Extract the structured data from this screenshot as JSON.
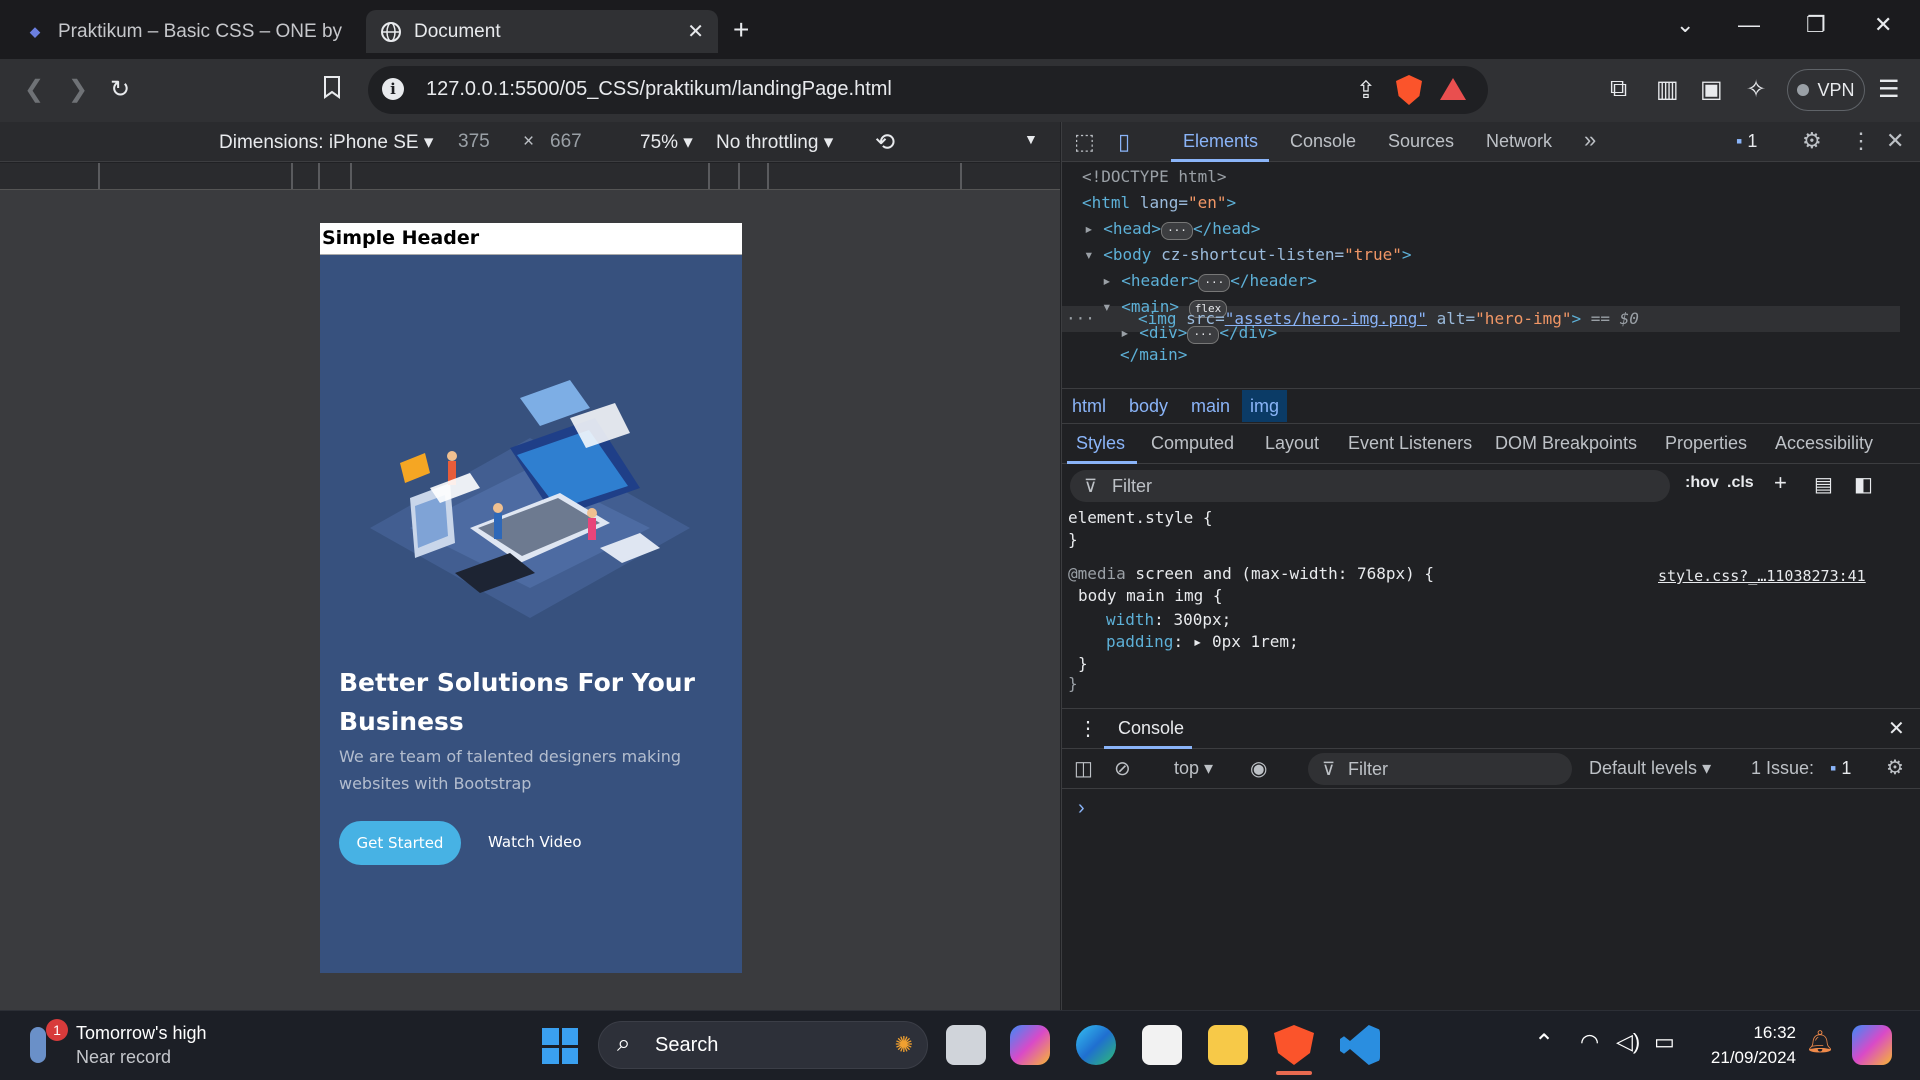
{
  "browser": {
    "tabs": [
      {
        "title": "Praktikum – Basic CSS – ONE by Alt",
        "active": false
      },
      {
        "title": "Document",
        "active": true
      }
    ],
    "url": "127.0.0.1:5500/05_CSS/praktikum/landingPage.html",
    "vpn_label": "VPN"
  },
  "device_toolbar": {
    "dimensions": "Dimensions: iPhone SE",
    "width": "375",
    "times": "×",
    "height": "667",
    "zoom": "75%",
    "throttling": "No throttling"
  },
  "page": {
    "header_title": "Simple Header",
    "hero_title": "Better Solutions For Your Business",
    "hero_subtitle": "We are team of talented designers making websites with Bootstrap",
    "cta_primary": "Get Started",
    "cta_secondary": "Watch Video"
  },
  "devtools": {
    "tabs": [
      "Elements",
      "Console",
      "Sources",
      "Network"
    ],
    "more": "»",
    "issues_count": "1",
    "dom": {
      "doctype": "<!DOCTYPE html>",
      "html_open": "<html",
      "html_attr": " lang=",
      "html_val": "\"en\"",
      "html_close": ">",
      "head": "<head>",
      "head_end": "</head>",
      "body_open": "<body",
      "body_attr": " cz-shortcut-listen=",
      "body_val": "\"true\"",
      "body_close": ">",
      "header": "<header>",
      "header_end": "</header>",
      "main": "<main>",
      "flex_badge": "flex",
      "div": "<div>",
      "div_end": "</div>",
      "img_open": "<img",
      "img_src_attr": " src=",
      "img_src_val": "\"assets/hero-img.png\"",
      "img_alt_attr": " alt=",
      "img_alt_val": "\"hero-img\"",
      "img_close": ">",
      "img_suffix": " == $0",
      "main_end": "</main>",
      "ellipsis": "···"
    },
    "breadcrumbs": [
      "html",
      "body",
      "main",
      "img"
    ],
    "subtabs": [
      "Styles",
      "Computed",
      "Layout",
      "Event Listeners",
      "DOM Breakpoints",
      "Properties",
      "Accessibility"
    ],
    "filter_placeholder": "Filter",
    "hov": ":hov",
    "cls": ".cls",
    "styles": {
      "element_style": "element.style {",
      "close_brace": "}",
      "media_at": "@media",
      "media_query": " screen and (max-width: 768px) {",
      "source": "style.css?_…11038273:41",
      "selector": "body main img {",
      "prop1_name": "width",
      "prop1_val": ": 300px;",
      "prop2_name": "padding",
      "prop2_val": ": ▸ 0px 1rem;",
      "rule_close": "}",
      "media_close": "}"
    },
    "console": {
      "tab": "Console",
      "context": "top",
      "filter_placeholder": "Filter",
      "levels": "Default levels",
      "issues_label": "1 Issue:",
      "issues_count": "1",
      "prompt": "›"
    }
  },
  "taskbar": {
    "weather_title": "Tomorrow's high",
    "weather_sub": "Near record",
    "weather_badge": "1",
    "search_label": "Search",
    "time": "16:32",
    "date": "21/09/2024"
  }
}
